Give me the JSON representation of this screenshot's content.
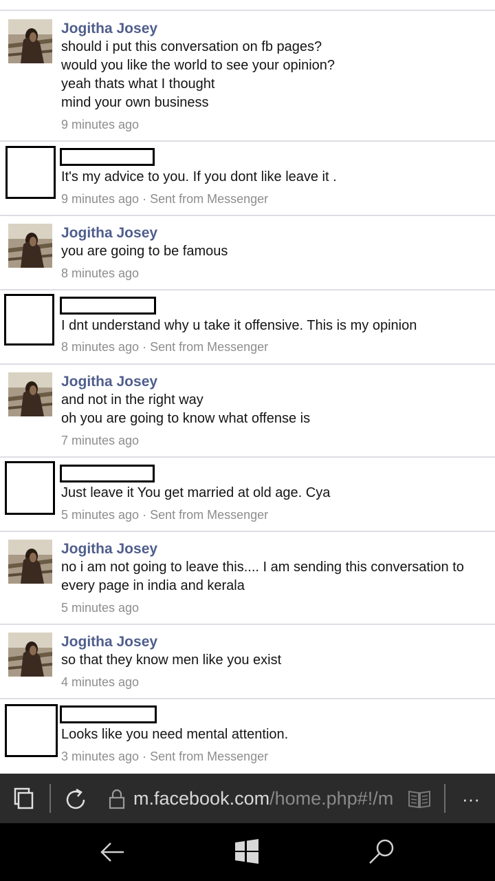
{
  "messages": [
    {
      "sender": "Jogitha Josey",
      "lines": [
        "should i put this conversation on fb pages?",
        "would you like the world to see your opinion?",
        "yeah thats what I thought",
        "mind your own business"
      ],
      "time": "9 minutes ago"
    },
    {
      "lines": [
        "It's my advice to you. If you dont like leave it ."
      ],
      "meta": "9 minutes ago · Sent from Messenger"
    },
    {
      "sender": "Jogitha Josey",
      "lines": [
        "you are going to be famous"
      ],
      "time": "8 minutes ago"
    },
    {
      "lines": [
        "I dnt understand why u take it offensive. This is my opinion"
      ],
      "meta": "8 minutes ago · Sent from Messenger"
    },
    {
      "sender": "Jogitha Josey",
      "lines": [
        "and not in the right way",
        "oh you are going to know what offense is"
      ],
      "time": "7 minutes ago"
    },
    {
      "lines": [
        "Just leave it You get married at old age. Cya"
      ],
      "meta": "5 minutes ago · Sent from Messenger"
    },
    {
      "sender": "Jogitha Josey",
      "lines": [
        "no i am not going to leave this.... I am sending this conversation to every page in india and kerala"
      ],
      "time": "5 minutes ago"
    },
    {
      "sender": "Jogitha Josey",
      "lines": [
        "so that they know men like you exist"
      ],
      "time": "4 minutes ago"
    },
    {
      "lines": [
        "Looks like you need mental attention."
      ],
      "meta": "3 minutes ago · Sent from Messenger"
    }
  ],
  "browser": {
    "url_host": "m.facebook.com",
    "url_path": "/home.php#!/m",
    "icons": [
      "tabs-icon",
      "refresh-icon",
      "lock-icon",
      "reading-view-icon",
      "more-icon"
    ],
    "more_label": "···"
  },
  "navbar": {
    "icons": [
      "back-icon",
      "windows-start-icon",
      "search-icon"
    ]
  },
  "colors": {
    "sender_name": "#4f5e8c",
    "message_text": "#141414",
    "timestamp": "#8d8d8d",
    "browser_bar": "#2b2b2b",
    "nav_bar": "#000000"
  }
}
